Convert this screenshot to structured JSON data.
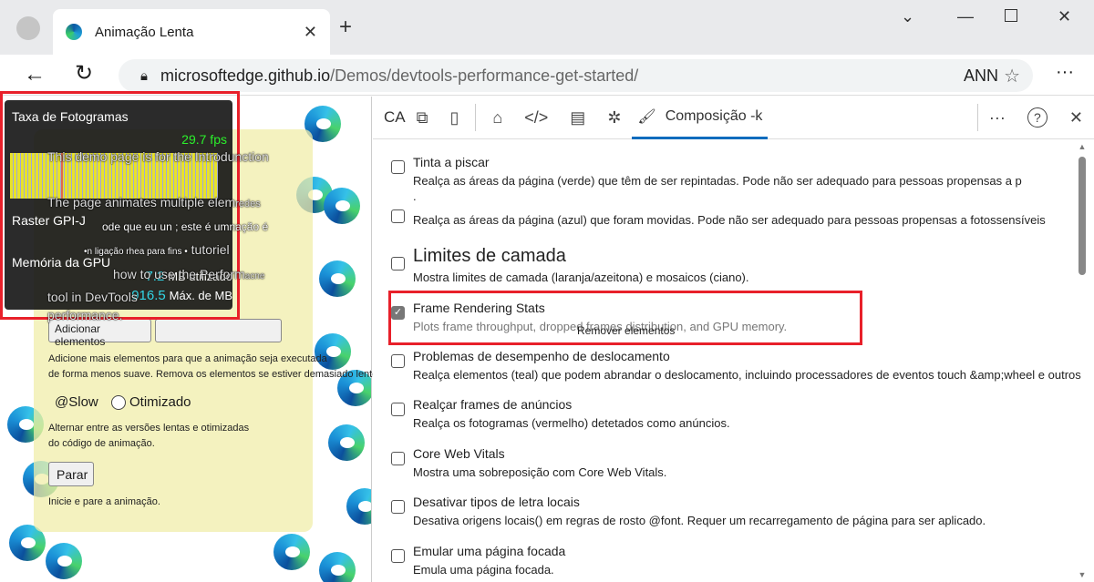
{
  "browser": {
    "tab_title": "Animação Lenta",
    "url_host": "microsoftedge.github.io",
    "url_path": "/Demos/devtools-performance-get-started/",
    "profile_label": "ANN"
  },
  "page": {
    "add_button": "Adicionar elementos",
    "add_desc_1": "Adicione mais elementos para que a animação seja executada",
    "add_desc_2": "de forma menos suave. Remova os elementos se estiver demasiado lento.",
    "slow_label": "@Slow",
    "optimized_label": "Otimizado",
    "toggle_desc_1": "Alternar entre as versões lentas e otimizadas",
    "toggle_desc_2": "do código de animação.",
    "stop_button": "Parar",
    "stop_desc": "Inicie e pare a animação.",
    "remove_button": "Remover elementos",
    "bg_text_1": "This demo page is for the Introd",
    "bg_text_1b": "unction",
    "bg_text_2": "The page animates multiple elem",
    "bg_text_2b": "redes",
    "bg_text_3": "ode que eu un ; este é um",
    "bg_text_3b": "nação é",
    "bg_text_4": "•n ligação rhea para fins •",
    "bg_text_4b": "tutoriel",
    "bg_text_5": "how to use the Perform",
    "bg_text_5b": "acne",
    "bg_text_6": "tool in DevTools",
    "bg_text_7": "performance."
  },
  "fps_meter": {
    "title": "Taxa de Fotogramas",
    "fps": "29.7 fps",
    "raster": "Raster GPI-J",
    "gpu_title": "Memória da GPU",
    "used_value": "7.2",
    "used_label": "MB utilizado",
    "max_value": "916.5",
    "max_label": "Máx. de MB"
  },
  "devtools": {
    "ca_label": "CA",
    "active_tab": "Composição -k",
    "items": [
      {
        "title": "Tinta a piscar",
        "desc": "Realça as áreas da página (verde) que têm de ser repintadas. Pode não ser adequado para pessoas propensas a p",
        "extra": ".",
        "checked": false
      },
      {
        "title": "",
        "desc": "Realça as áreas da página (azul) que foram movidas.  Pode não ser adequado para pessoas propensas a fotossensíveis",
        "checked": false
      },
      {
        "title": "Limites de camada",
        "desc": "Mostra limites de camada (laranja/azeitona) e mosaicos (ciano).",
        "checked": false
      },
      {
        "title": "Frame Rendering Stats",
        "desc": "Plots frame throughput, dropped frames distribution, and GPU memory.",
        "checked": true
      },
      {
        "title": "Problemas de desempenho de deslocamento",
        "desc": "Realça elementos (teal) que podem abrandar o deslocamento, incluindo processadores de eventos touch &amp;wheel e outros",
        "checked": false
      },
      {
        "title": "Realçar frames de anúncios",
        "desc": "Realça os fotogramas (vermelho) detetados como anúncios.",
        "checked": false
      },
      {
        "title": "Core Web Vitals",
        "desc": "Mostra uma sobreposição com Core Web Vitals.",
        "checked": false
      },
      {
        "title": "Desativar tipos de letra locais",
        "desc": "Desativa origens locais() em regras de rosto @font. Requer um recarregamento de página para ser aplicado.",
        "checked": false
      },
      {
        "title": "Emular uma página focada",
        "desc": "Emula uma página focada.",
        "checked": false
      }
    ]
  }
}
